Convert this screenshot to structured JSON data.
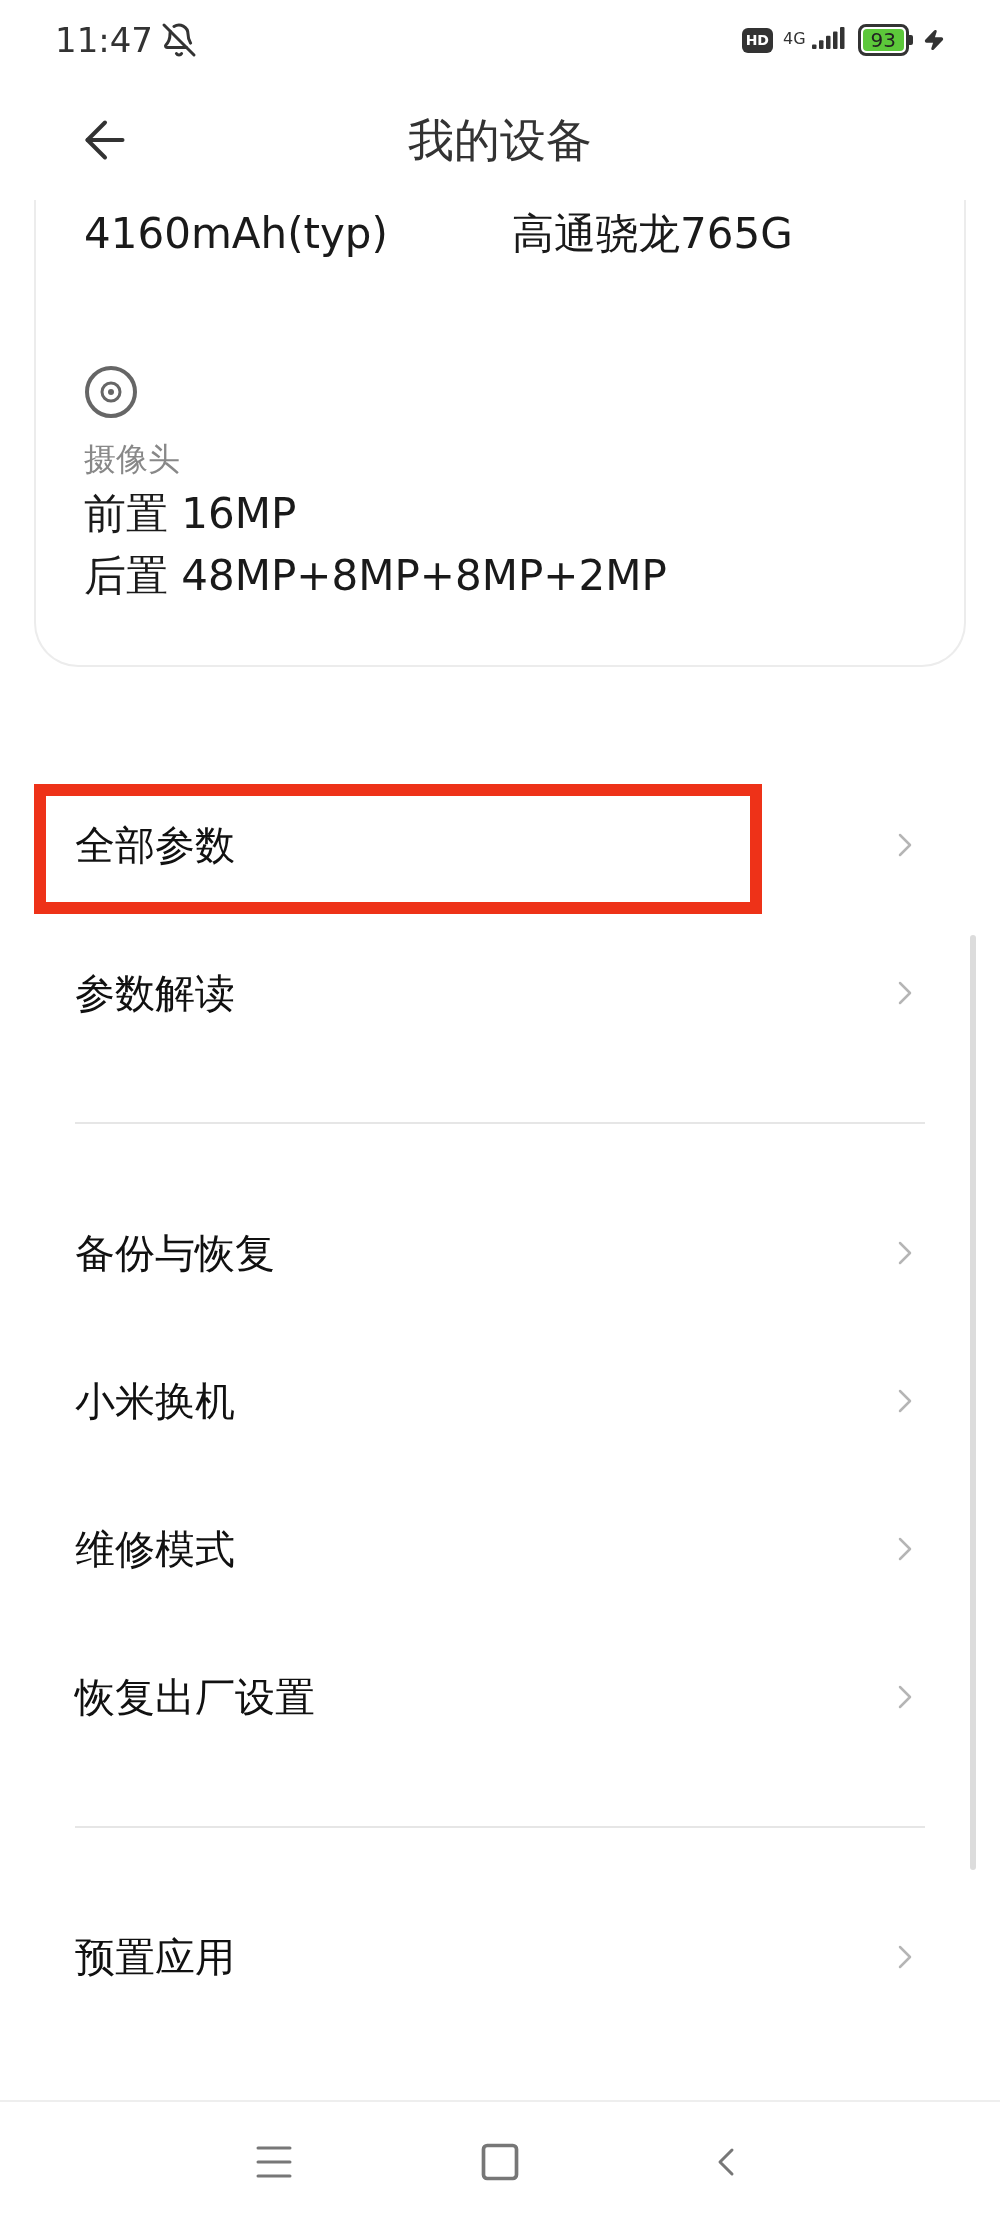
{
  "status_bar": {
    "time": "11:47",
    "hd": "HD",
    "network": "4G",
    "battery": "93"
  },
  "header": {
    "title": "我的设备"
  },
  "card": {
    "specs": [
      "4160mAh(typ)",
      "高通骁龙765G"
    ],
    "camera": {
      "label": "摄像头",
      "lines": [
        "前置 16MP",
        "后置 48MP+8MP+8MP+2MP"
      ]
    }
  },
  "sections": [
    {
      "items": [
        {
          "label": "全部参数",
          "highlighted": true
        },
        {
          "label": "参数解读",
          "highlighted": false
        }
      ]
    },
    {
      "items": [
        {
          "label": "备份与恢复",
          "highlighted": false
        },
        {
          "label": "小米换机",
          "highlighted": false
        },
        {
          "label": "维修模式",
          "highlighted": false
        },
        {
          "label": "恢复出厂设置",
          "highlighted": false
        }
      ]
    },
    {
      "items": [
        {
          "label": "预置应用",
          "highlighted": false
        }
      ]
    }
  ]
}
